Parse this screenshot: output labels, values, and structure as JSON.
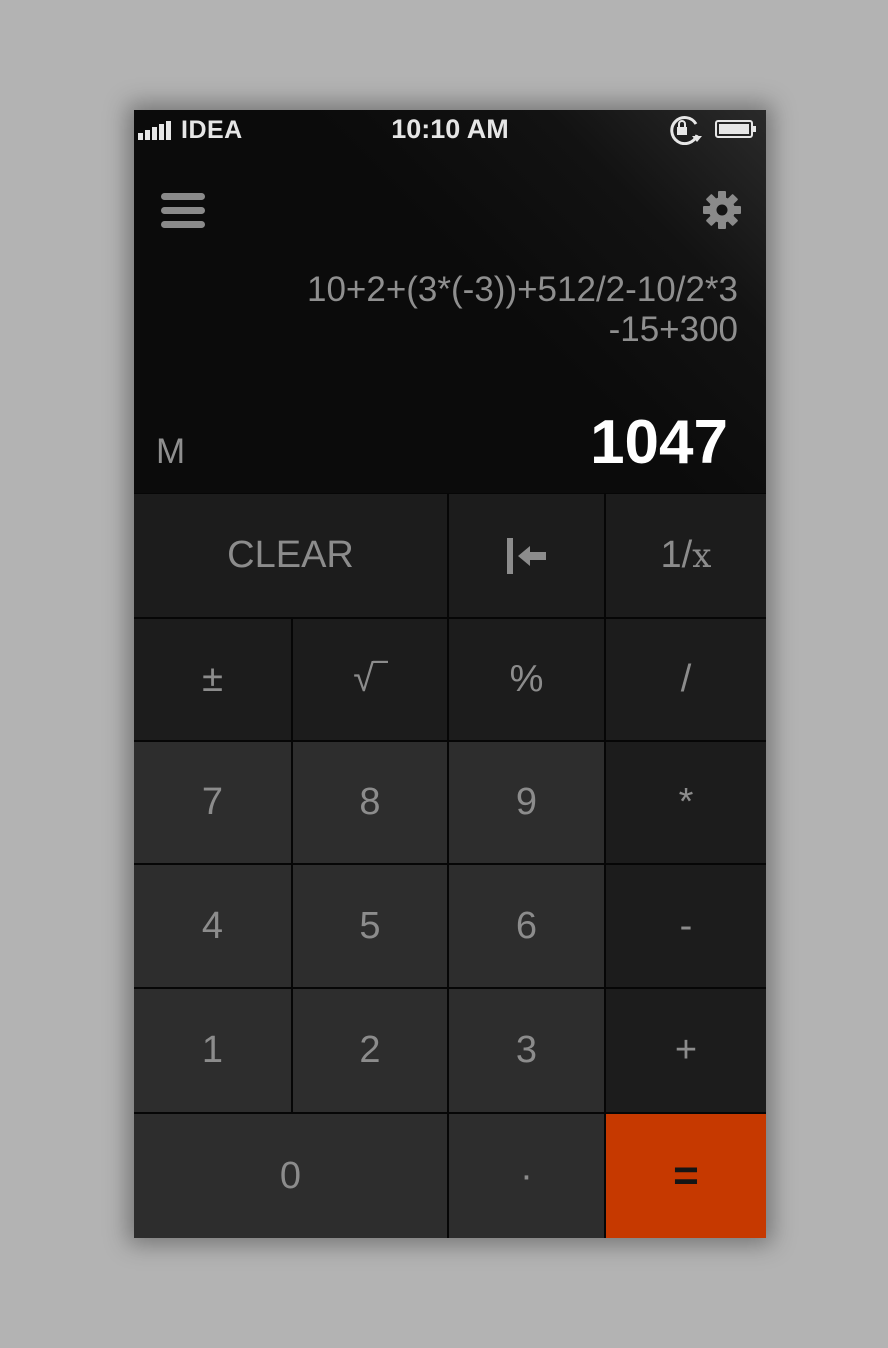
{
  "status_bar": {
    "carrier": "IDEA",
    "time": "10:10 AM"
  },
  "header": {
    "menu_icon": "hamburger-menu-icon",
    "settings_icon": "gear-icon"
  },
  "display": {
    "expression_line1": "10+2+(3*(-3))+512/2-10/2*3",
    "expression_line2": "-15+300",
    "memory_indicator": "M",
    "result": "1047"
  },
  "keys": {
    "clear": "CLEAR",
    "backspace_icon": "backspace-icon",
    "reciprocal_prefix": "1/",
    "reciprocal_var": "x",
    "plus_minus": "±",
    "sqrt": "√‾",
    "percent": "%",
    "divide": "/",
    "seven": "7",
    "eight": "8",
    "nine": "9",
    "multiply": "*",
    "four": "4",
    "five": "5",
    "six": "6",
    "minus": "-",
    "one": "1",
    "two": "2",
    "three": "3",
    "plus": "+",
    "zero": "0",
    "decimal": "·",
    "equals": "="
  },
  "colors": {
    "background": "#b3b3b3",
    "display_bg": "#0b0b0b",
    "function_key": "#1c1c1c",
    "number_key": "#2d2d2d",
    "equals_key": "#c63900",
    "key_text": "#8c8c8c",
    "result_text": "#ffffff"
  }
}
